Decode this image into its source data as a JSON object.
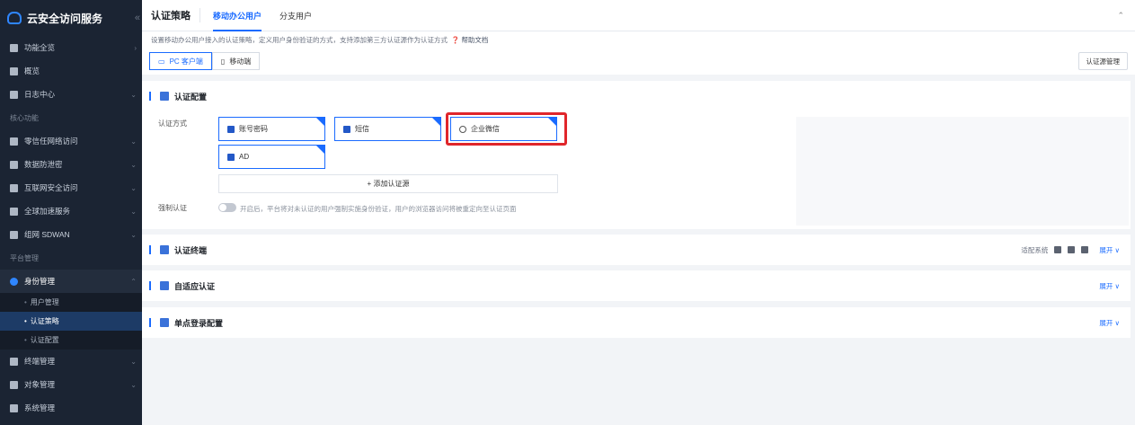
{
  "app": {
    "title": "云安全访问服务",
    "collapse_icon": "double-chevron-left"
  },
  "sidebar": {
    "items": [
      {
        "label": "功能全览",
        "icon": "grid-icon"
      },
      {
        "label": "概览",
        "icon": "dashboard-icon"
      },
      {
        "label": "日志中心",
        "icon": "log-icon"
      }
    ],
    "group_core": "核心功能",
    "core_items": [
      {
        "label": "零信任网络访问",
        "icon": "shield-icon"
      },
      {
        "label": "数据防泄密",
        "icon": "data-icon"
      },
      {
        "label": "互联网安全访问",
        "icon": "globe-shield-icon"
      },
      {
        "label": "全球加速服务",
        "icon": "rocket-icon"
      },
      {
        "label": "组网 SDWAN",
        "icon": "network-icon"
      }
    ],
    "group_platform": "平台管理",
    "identity": {
      "label": "身份管理",
      "icon": "identity-icon"
    },
    "identity_sub": [
      "用户管理",
      "认证策略",
      "认证配置"
    ],
    "bottom_items": [
      {
        "label": "终端管理",
        "icon": "terminal-icon"
      },
      {
        "label": "对象管理",
        "icon": "object-icon"
      },
      {
        "label": "系统管理",
        "icon": "settings-icon"
      }
    ]
  },
  "header": {
    "title": "认证策略",
    "tabs": [
      "移动办公用户",
      "分支用户"
    ],
    "active_tab": "移动办公用户"
  },
  "description": {
    "text": "设置移动办公用户接入的认证策略，定义用户身份验证的方式，支持添加第三方认证源作为认证方式",
    "help": "帮助文档"
  },
  "client_switch": {
    "pc": "PC 客户端",
    "mobile": "移动端",
    "active": "PC 客户端"
  },
  "manage_button": "认证源管理",
  "auth_config": {
    "title": "认证配置",
    "method_label": "认证方式",
    "methods": [
      "账号密码",
      "短信",
      "企业微信",
      "AD"
    ],
    "add_label": "+ 添加认证源",
    "force_label": "强制认证",
    "force_hint": "开启后，平台将对未认证的用户强制实施身份验证，用户的浏览器访问将被重定向至认证页面",
    "force_enabled": false
  },
  "sections": [
    {
      "title": "认证终端",
      "right_label": "适配系统",
      "expand": "展开 ∨"
    },
    {
      "title": "自适应认证",
      "expand": "展开 ∨"
    },
    {
      "title": "单点登录配置",
      "expand": "展开 ∨"
    }
  ],
  "colors": {
    "accent": "#1a6bff",
    "sidebar": "#1b2433",
    "highlight": "#e0262b"
  }
}
